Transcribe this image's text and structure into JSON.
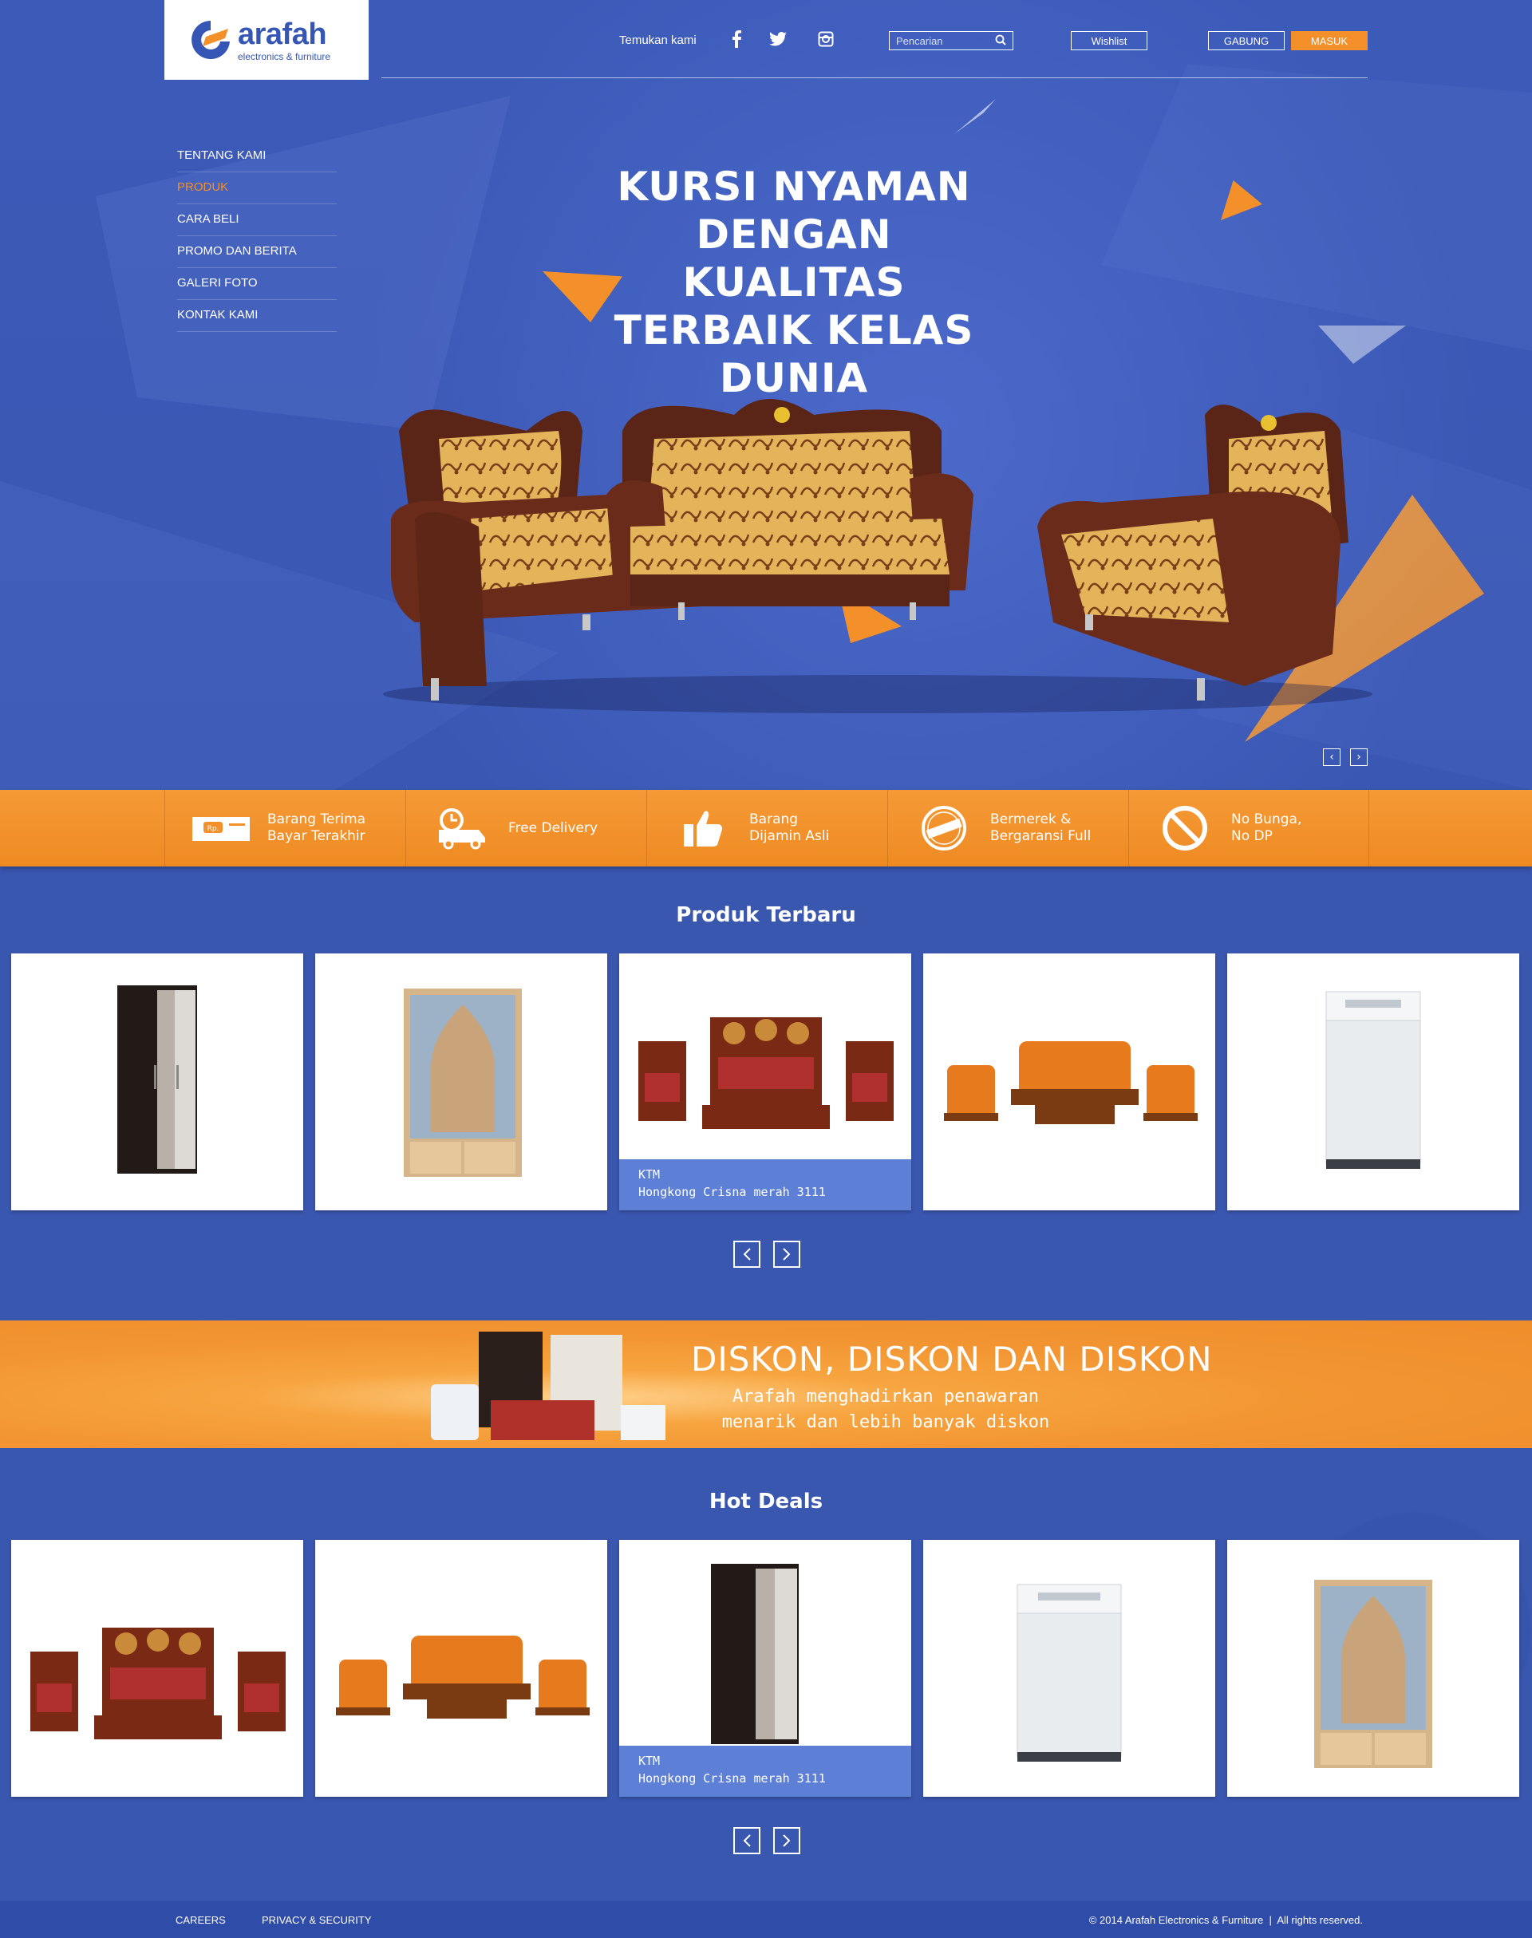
{
  "brand": {
    "name": "arafah",
    "tagline": "electronics & furniture"
  },
  "topbar": {
    "find_us": "Temukan kami",
    "social": [
      "facebook-icon",
      "twitter-icon",
      "instagram-icon"
    ],
    "search_placeholder": "Pencarian",
    "wishlist": "Wishlist",
    "join": "GABUNG",
    "login": "MASUK"
  },
  "nav": [
    {
      "label": "TENTANG KAMI",
      "active": false
    },
    {
      "label": "PRODUK",
      "active": true
    },
    {
      "label": "CARA BELI",
      "active": false
    },
    {
      "label": "PROMO DAN BERITA",
      "active": false
    },
    {
      "label": "GALERI FOTO",
      "active": false
    },
    {
      "label": "KONTAK KAMI",
      "active": false
    }
  ],
  "hero": {
    "title": "KURSI NYAMAN DENGAN KUALITAS TERBAIK KELAS DUNIA"
  },
  "features": [
    {
      "icon": "cash-icon",
      "text": "Barang Terima\nBayar Terakhir"
    },
    {
      "icon": "delivery-truck-icon",
      "text": "Free Delivery"
    },
    {
      "icon": "thumbs-up-icon",
      "text": "Barang\nDijamin Asli"
    },
    {
      "icon": "guarantee-badge-icon",
      "text": "Bermerek &\nBergaransi Full"
    },
    {
      "icon": "no-sign-icon",
      "text": "No Bunga,\nNo DP"
    }
  ],
  "latest": {
    "title": "Produk Terbaru",
    "products": [
      {
        "type": "wardrobe"
      },
      {
        "type": "cabinet"
      },
      {
        "type": "carved-sofa-set",
        "brand": "KTM",
        "name": "Hongkong Crisna merah 3111"
      },
      {
        "type": "orange-sofa-set"
      },
      {
        "type": "washing-machine"
      }
    ]
  },
  "promo": {
    "title": "DISKON, DISKON DAN DISKON",
    "subtitle": "Arafah menghadirkan penawaran menarik dan lebih banyak diskon"
  },
  "hot": {
    "title": "Hot Deals",
    "products": [
      {
        "type": "carved-sofa-set"
      },
      {
        "type": "orange-sofa-set"
      },
      {
        "type": "wardrobe",
        "brand": "KTM",
        "name": "Hongkong Crisna merah 3111"
      },
      {
        "type": "washing-machine"
      },
      {
        "type": "cabinet"
      }
    ]
  },
  "footer": {
    "careers": "CAREERS",
    "privacy": "PRIVACY & SECURITY",
    "copyright": "© 2014 Arafah Electronics & Furniture  |  All rights reserved."
  },
  "colors": {
    "blue": "#3a57b0",
    "orange": "#f4902a",
    "caption": "#5d80d6"
  }
}
